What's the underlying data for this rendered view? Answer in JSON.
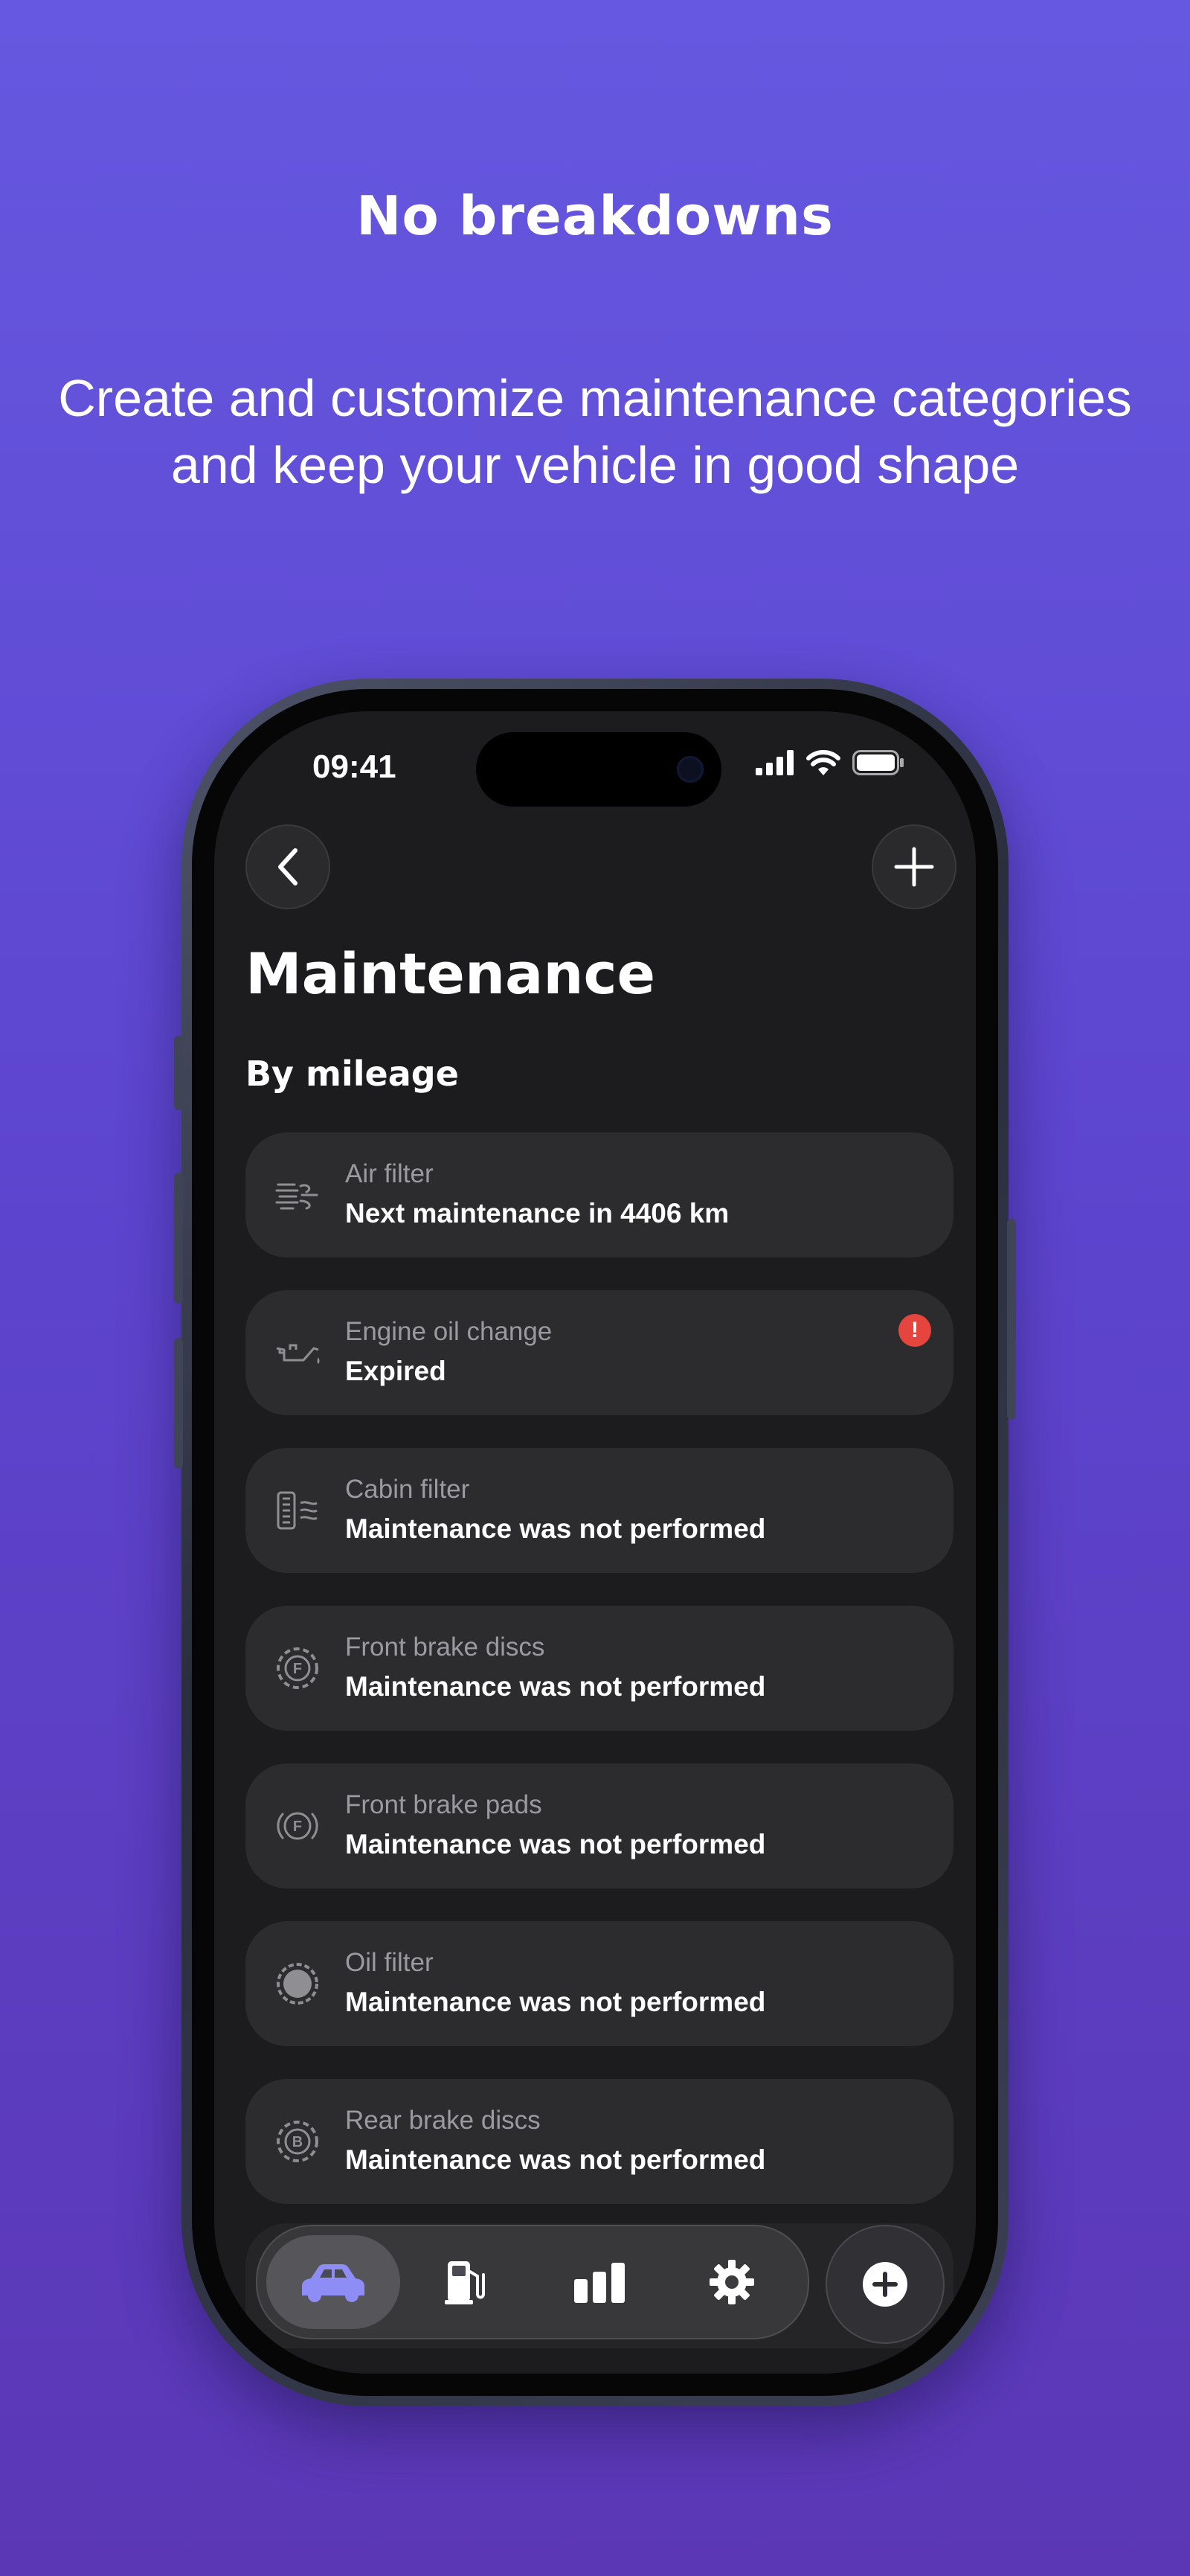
{
  "promo": {
    "headline": "No breakdowns",
    "subline_1": "Create and customize maintenance categories",
    "subline_2": "and keep your vehicle in good shape"
  },
  "status_bar": {
    "time": "09:41"
  },
  "header": {
    "title": "Maintenance",
    "back_icon": "chevron-left-icon",
    "add_icon": "plus-icon"
  },
  "section": {
    "title": "By mileage"
  },
  "items": [
    {
      "label": "Air filter",
      "value": "Next maintenance in 4406 km",
      "icon": "air-filter-icon",
      "alert": false
    },
    {
      "label": "Engine oil change",
      "value": "Expired",
      "icon": "oil-can-icon",
      "alert": true,
      "alert_symbol": "!"
    },
    {
      "label": "Cabin filter",
      "value": "Maintenance was not performed",
      "icon": "cabin-filter-icon",
      "alert": false
    },
    {
      "label": "Front brake discs",
      "value": "Maintenance was not performed",
      "icon": "front-brake-disc-icon",
      "alert": false
    },
    {
      "label": "Front brake pads",
      "value": "Maintenance was not performed",
      "icon": "front-brake-pads-icon",
      "alert": false
    },
    {
      "label": "Oil filter",
      "value": "Maintenance was not performed",
      "icon": "oil-filter-icon",
      "alert": false
    },
    {
      "label": "Rear brake discs",
      "value": "Maintenance was not performed",
      "icon": "rear-brake-disc-icon",
      "alert": false
    }
  ],
  "tabbar": {
    "tabs": [
      {
        "name": "car-icon",
        "active": true
      },
      {
        "name": "fuel-icon",
        "active": false
      },
      {
        "name": "stats-icon",
        "active": false
      },
      {
        "name": "settings-icon",
        "active": false
      }
    ],
    "fab_icon": "plus-circle-icon"
  },
  "colors": {
    "accent": "#8e8cf5",
    "alert": "#e5453c",
    "card": "#2c2c2e",
    "screen": "#1c1c1e"
  }
}
